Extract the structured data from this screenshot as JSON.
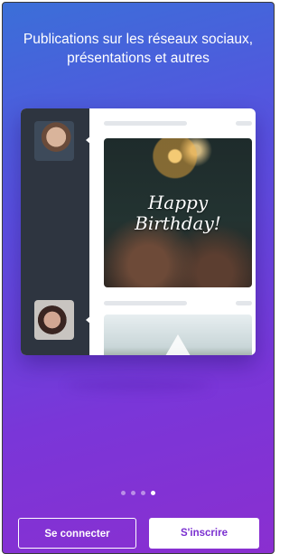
{
  "onboarding": {
    "headline_line1": "Publications sur les réseaux sociaux,",
    "headline_line2": "présentations et autres",
    "card": {
      "post1": {
        "text_line1": "Happy",
        "text_line2": "Birthday!"
      }
    },
    "pagination": {
      "total": 4,
      "active_index": 3
    },
    "buttons": {
      "login_label": "Se connecter",
      "signup_label": "S'inscrire"
    }
  },
  "colors": {
    "gradient_start": "#3b6fd8",
    "gradient_end": "#8a2fd0",
    "accent_text": "#7a2fd0"
  }
}
